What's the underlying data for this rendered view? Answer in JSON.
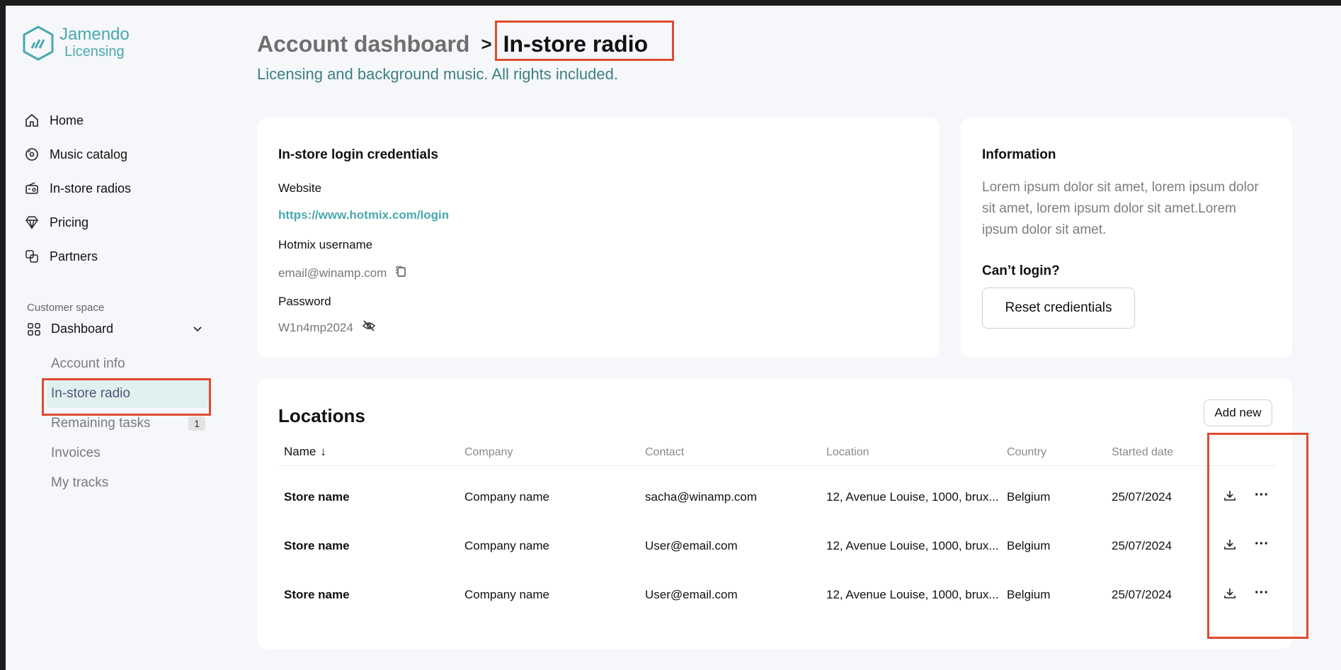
{
  "brand": {
    "line1": "Jamendo",
    "line2": "Licensing",
    "color": "#4aa8ad"
  },
  "nav": {
    "items": [
      {
        "label": "Home",
        "icon": "home-icon"
      },
      {
        "label": "Music catalog",
        "icon": "disc-icon"
      },
      {
        "label": "In-store radios",
        "icon": "radio-icon"
      },
      {
        "label": "Pricing",
        "icon": "diamond-icon"
      },
      {
        "label": "Partners",
        "icon": "partners-icon"
      }
    ],
    "section_label": "Customer space",
    "dashboard": "Dashboard",
    "sub_items": [
      {
        "label": "Account info"
      },
      {
        "label": "In-store radio"
      },
      {
        "label": "Remaining tasks",
        "badge": "1"
      },
      {
        "label": "Invoices"
      },
      {
        "label": "My tracks"
      }
    ]
  },
  "header": {
    "breadcrumb_parent": "Account dashboard",
    "breadcrumb_sep": ">",
    "breadcrumb_current": "In-store radio",
    "subtitle": "Licensing and background music. All rights included."
  },
  "credentials": {
    "title": "In-store login credentials",
    "website_label": "Website",
    "website_value": "https://www.hotmix.com/login",
    "username_label": "Hotmix username",
    "username_value": "email@winamp.com",
    "password_label": "Password",
    "password_value": "W1n4mp2024"
  },
  "info": {
    "title": "Information",
    "body": "Lorem ipsum dolor sit amet, lorem ipsum dolor sit amet, lorem ipsum dolor sit amet.Lorem ipsum dolor sit amet.",
    "cant_login": "Can’t login?",
    "reset_button": "Reset credientials"
  },
  "locations": {
    "title": "Locations",
    "add_button": "Add new",
    "columns": [
      "Name",
      "Company",
      "Contact",
      "Location",
      "Country",
      "Started date"
    ],
    "sort_indicator": "↓",
    "rows": [
      [
        "Store name",
        "Company name",
        "sacha@winamp.com",
        "12, Avenue Louise, 1000, brux...",
        "Belgium",
        "25/07/2024"
      ],
      [
        "Store name",
        "Company name",
        "User@email.com",
        "12, Avenue Louise, 1000, brux...",
        "Belgium",
        "25/07/2024"
      ],
      [
        "Store name",
        "Company name",
        "User@email.com",
        "12, Avenue Louise, 1000, brux...",
        "Belgium",
        "25/07/2024"
      ]
    ]
  },
  "colors": {
    "highlight": "#e04a2e",
    "accent": "#4aa8ad",
    "active_bg": "#dff1ef"
  }
}
